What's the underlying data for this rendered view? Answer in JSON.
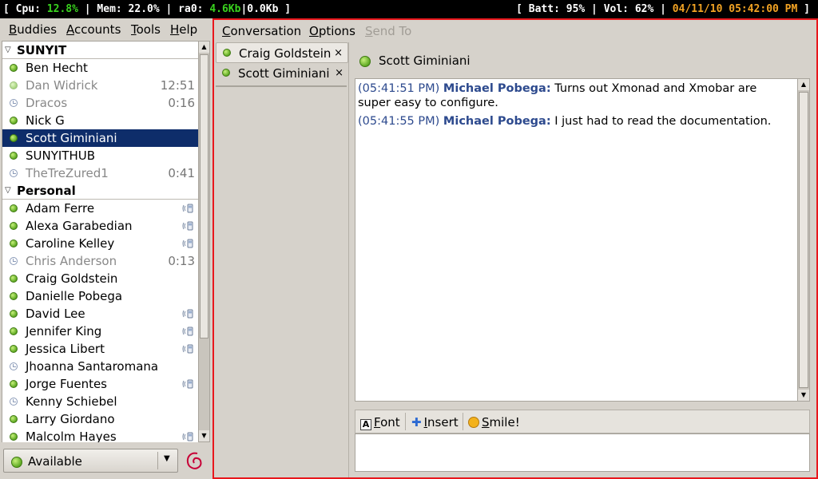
{
  "xmobar": {
    "cpu_label": "[ Cpu: ",
    "cpu_value": "12.8%",
    "mem": " | Mem: 22.0% | ra0: ",
    "net_down": "4.6Kb",
    "net_up": "|0.0Kb ]",
    "batt_vol": "[ Batt: 95% | Vol: 62% | ",
    "datetime": "04/11/10 05:42:00 PM",
    "close": " ]",
    "colors": {
      "green": "#39d21e",
      "orange": "#f2a324"
    }
  },
  "buddy_window": {
    "menu": {
      "buddies_u": "B",
      "buddies": "uddies",
      "accounts_u": "A",
      "accounts": "ccounts",
      "tools_u": "T",
      "tools": "ools",
      "help_u": "H",
      "help": "elp"
    },
    "groups": [
      {
        "name": "SUNYIT",
        "buddies": [
          {
            "name": "Ben Hecht",
            "status": "available",
            "idle": ""
          },
          {
            "name": "Dan Widrick",
            "status": "idle",
            "idle": "12:51"
          },
          {
            "name": "Dracos",
            "status": "away",
            "idle": "0:16"
          },
          {
            "name": "Nick G",
            "status": "available",
            "idle": ""
          },
          {
            "name": "Scott Giminiani",
            "status": "available",
            "idle": "",
            "selected": true
          },
          {
            "name": "SUNYITHUB",
            "status": "available",
            "idle": ""
          },
          {
            "name": "TheTreZured1",
            "status": "away",
            "idle": "0:41"
          }
        ]
      },
      {
        "name": "Personal",
        "buddies": [
          {
            "name": "Adam Ferre",
            "status": "available",
            "mobile": true
          },
          {
            "name": "Alexa Garabedian",
            "status": "available",
            "mobile": true
          },
          {
            "name": "Caroline Kelley",
            "status": "available",
            "mobile": true
          },
          {
            "name": "Chris Anderson",
            "status": "away",
            "idle": "0:13"
          },
          {
            "name": "Craig Goldstein",
            "status": "available"
          },
          {
            "name": "Danielle Pobega",
            "status": "available"
          },
          {
            "name": "David Lee",
            "status": "available",
            "mobile": true
          },
          {
            "name": "Jennifer King",
            "status": "available",
            "mobile": true
          },
          {
            "name": "Jessica Libert",
            "status": "available",
            "mobile": true
          },
          {
            "name": "Jhoanna Santaromana",
            "status": "away-active"
          },
          {
            "name": "Jorge Fuentes",
            "status": "available",
            "mobile": true
          },
          {
            "name": "Kenny Schiebel",
            "status": "away-active"
          },
          {
            "name": "Larry Giordano",
            "status": "available"
          },
          {
            "name": "Malcolm Hayes",
            "status": "available",
            "mobile": true
          }
        ]
      }
    ],
    "status_selector": "Available"
  },
  "conv_window": {
    "menu": {
      "conversation_u": "C",
      "conversation": "onversation",
      "options_u": "O",
      "options": "ptions",
      "sendto_u": "S",
      "sendto": "end To"
    },
    "tabs": [
      {
        "label": "Craig Goldstein",
        "close": "×"
      },
      {
        "label": "Scott Giminiani",
        "close": "×"
      }
    ],
    "header_name": "Scott Giminiani",
    "messages": [
      {
        "time": "(05:41:51 PM)",
        "sender": "Michael Pobega:",
        "text": " Turns out Xmonad and Xmobar are super easy to configure."
      },
      {
        "time": "(05:41:55 PM)",
        "sender": "Michael Pobega:",
        "text": " I just had to read the documentation."
      }
    ],
    "toolbar": {
      "font_u": "F",
      "font": "ont",
      "font_glyph": "A",
      "insert_u": "I",
      "insert": "nsert",
      "insert_glyph": "✚",
      "smile_u": "S",
      "smile": "mile!"
    }
  }
}
